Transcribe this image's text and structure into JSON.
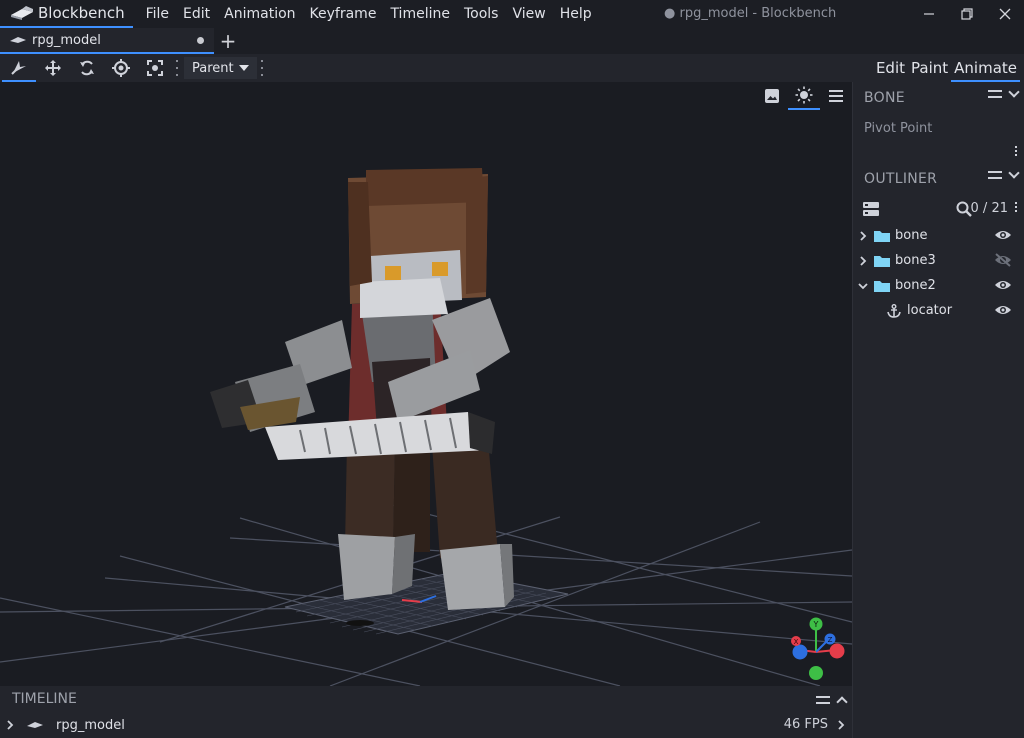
{
  "app": {
    "name": "Blockbench",
    "window_title": "● rpg_model - Blockbench",
    "logo_icon": "blockbench-logo-icon"
  },
  "menu": [
    "File",
    "Edit",
    "Animation",
    "Keyframe",
    "Timeline",
    "Tools",
    "View",
    "Help"
  ],
  "tabs": [
    {
      "label": "rpg_model",
      "icon": "model-icon",
      "unsaved": true
    }
  ],
  "toolbar": {
    "tools": [
      "animate-tool-icon",
      "move-icon",
      "rotate-icon",
      "pivot-icon",
      "vertex-snap-icon"
    ],
    "transform_space": "Parent"
  },
  "modes": [
    "Edit",
    "Paint",
    "Animate"
  ],
  "active_mode": "Animate",
  "viewport": {
    "tools": [
      "screenshot-icon",
      "brightness-icon",
      "menu-icon"
    ],
    "gizmo_axes": {
      "x": "X",
      "y": "Y",
      "z": "Z"
    },
    "colors": {
      "x": "#e53d4a",
      "y": "#3ebf46",
      "z": "#2d6fe0",
      "background": "#1a1c22",
      "grid": "#4c5160"
    }
  },
  "panels": {
    "bone": {
      "title": "BONE",
      "pivot_label": "Pivot Point"
    },
    "outliner": {
      "title": "OUTLINER",
      "count": "0 / 21",
      "nodes": [
        {
          "name": "bone",
          "type": "group",
          "expanded": false,
          "visible": true
        },
        {
          "name": "bone3",
          "type": "group",
          "expanded": false,
          "visible": false
        },
        {
          "name": "bone2",
          "type": "group",
          "expanded": true,
          "visible": true
        },
        {
          "name": "locator",
          "type": "locator",
          "visible": true
        }
      ]
    }
  },
  "timeline": {
    "title": "TIMELINE",
    "model_name": "rpg_model",
    "fps": "46 FPS"
  },
  "accent_color": "#3e90ff"
}
